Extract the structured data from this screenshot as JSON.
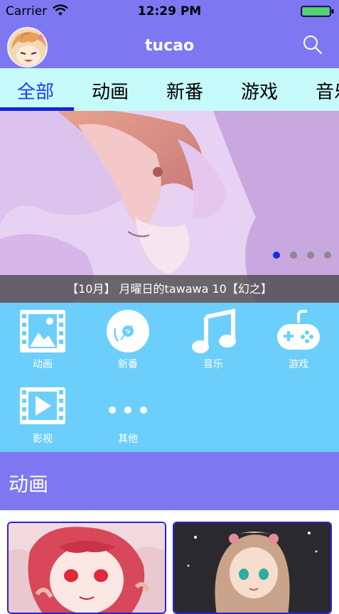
{
  "status_bar": {
    "carrier": "Carrier",
    "time": "12:29 PM",
    "battery_color": "#4CD964"
  },
  "nav": {
    "title": "tucao"
  },
  "tabs": [
    {
      "label": "全部",
      "active": true
    },
    {
      "label": "动画",
      "active": false
    },
    {
      "label": "新番",
      "active": false
    },
    {
      "label": "游戏",
      "active": false
    },
    {
      "label": "音乐",
      "active": false
    }
  ],
  "banner": {
    "caption": "【10月】 月曜日的tawawa 10【幻之】",
    "page_count": 4,
    "active_index": 0
  },
  "categories": [
    {
      "label": "动画",
      "icon": "film-icon"
    },
    {
      "label": "新番",
      "icon": "disc-icon"
    },
    {
      "label": "音乐",
      "icon": "music-note-icon"
    },
    {
      "label": "游戏",
      "icon": "gamepad-icon"
    },
    {
      "label": "影视",
      "icon": "video-play-icon"
    },
    {
      "label": "其他",
      "icon": "more-dots-icon"
    }
  ],
  "section": {
    "title": "动画"
  },
  "colors": {
    "header_purple": "#7D78F2",
    "tab_bg": "#C7FAFA",
    "tab_active": "#1E3BFF",
    "grid_blue": "#6CCFFB"
  }
}
